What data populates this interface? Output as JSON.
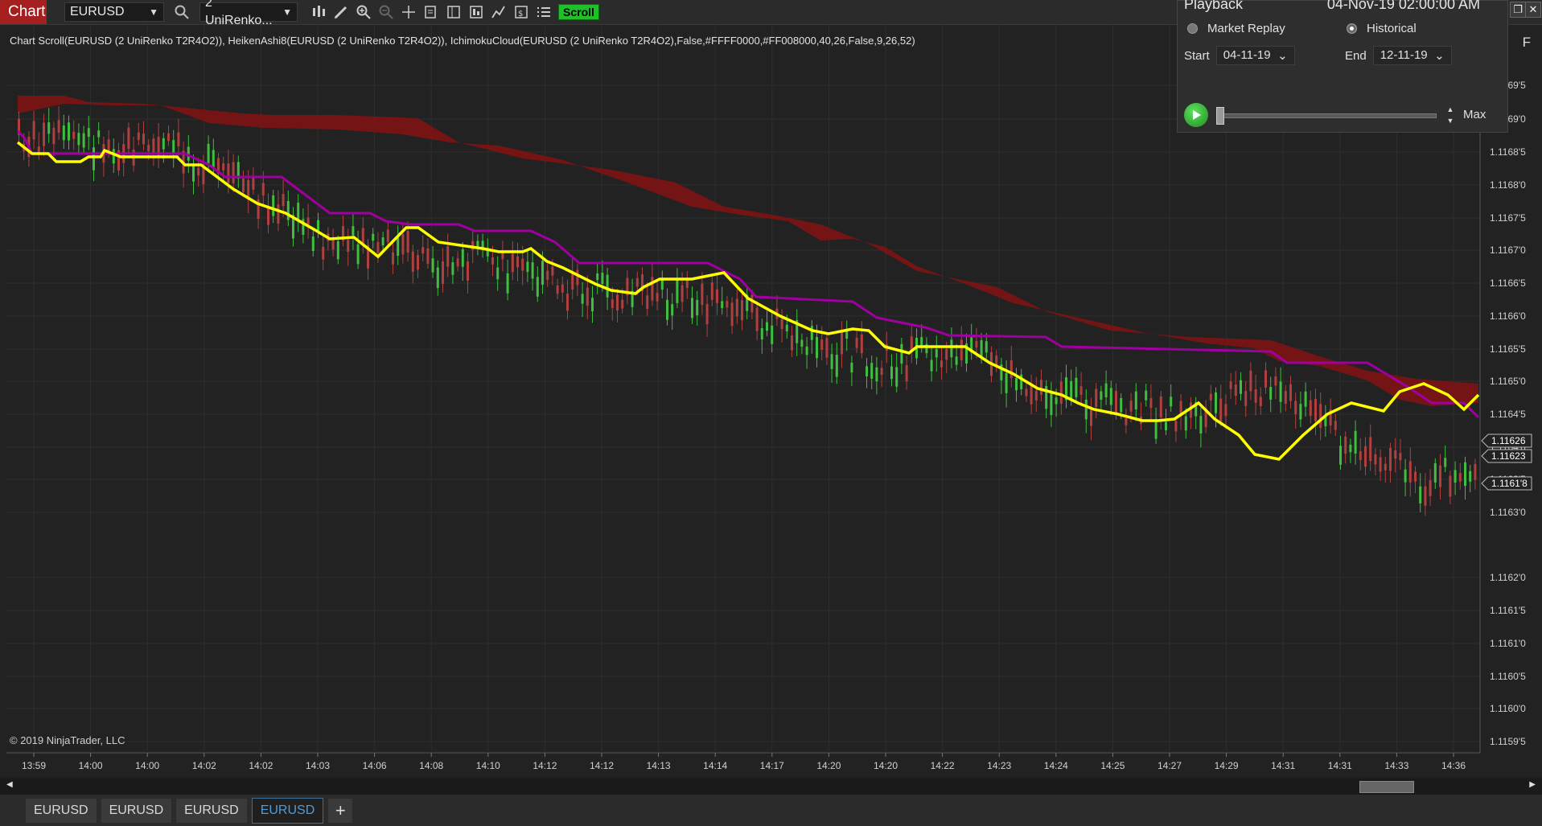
{
  "toolbar": {
    "chart_label": "Chart",
    "instrument": "EURUSD",
    "bar_type": "2 UniRenko...",
    "scroll_label": "Scroll"
  },
  "chart": {
    "indicator_label": "Chart Scroll(EURUSD (2 UniRenko T2R4O2)), HeikenAshi8(EURUSD (2 UniRenko T2R4O2)), IchimokuCloud(EURUSD (2 UniRenko T2R4O2),False,#FFFF0000,#FF008000,40,26,False,9,26,52)",
    "copyright": "© 2019 NinjaTrader, LLC",
    "side_letter": "F",
    "price_labels": [
      "1.1169'5",
      "1.1169'0",
      "1.1168'5",
      "1.1168'0",
      "1.1167'5",
      "1.1167'0",
      "1.1166'5",
      "1.1166'0",
      "1.1165'5",
      "1.1165'0",
      "1.1164'5",
      "1.1164'0",
      "1.1163'5",
      "1.1163'0",
      "1.1162'0",
      "1.1161'5",
      "1.1161'0",
      "1.1160'5",
      "1.1160'0",
      "1.1159'5"
    ],
    "price_tags": [
      {
        "label": "1.11626",
        "color": "#222222"
      },
      {
        "label": "1.11623",
        "color": "#222222"
      },
      {
        "label": "1.1161'8",
        "color": "#222222"
      }
    ],
    "time_labels": [
      "13:59",
      "14:00",
      "14:00",
      "14:02",
      "14:02",
      "14:03",
      "14:06",
      "14:08",
      "14:10",
      "14:12",
      "14:12",
      "14:13",
      "14:14",
      "14:17",
      "14:20",
      "14:20",
      "14:22",
      "14:23",
      "14:24",
      "14:25",
      "14:27",
      "14:29",
      "14:31",
      "14:31",
      "14:33",
      "14:36"
    ],
    "colors": {
      "cloud": "#7a1414",
      "tenkan": "#ffff00",
      "kijun": "#a000a0",
      "candle_up": "#3fbf3f",
      "candle_down": "#b04040"
    },
    "price_range": [
      1.11595,
      1.11695
    ]
  },
  "playback": {
    "title": "Playback",
    "time": "04-Nov-19 02:00:00 AM",
    "market_replay": "Market Replay",
    "historical": "Historical",
    "start_label": "Start",
    "start_value": "04-11-19",
    "end_label": "End",
    "end_value": "12-11-19",
    "max_label": "Max"
  },
  "tabs": [
    "EURUSD",
    "EURUSD",
    "EURUSD",
    "EURUSD"
  ],
  "tab_add": "+"
}
